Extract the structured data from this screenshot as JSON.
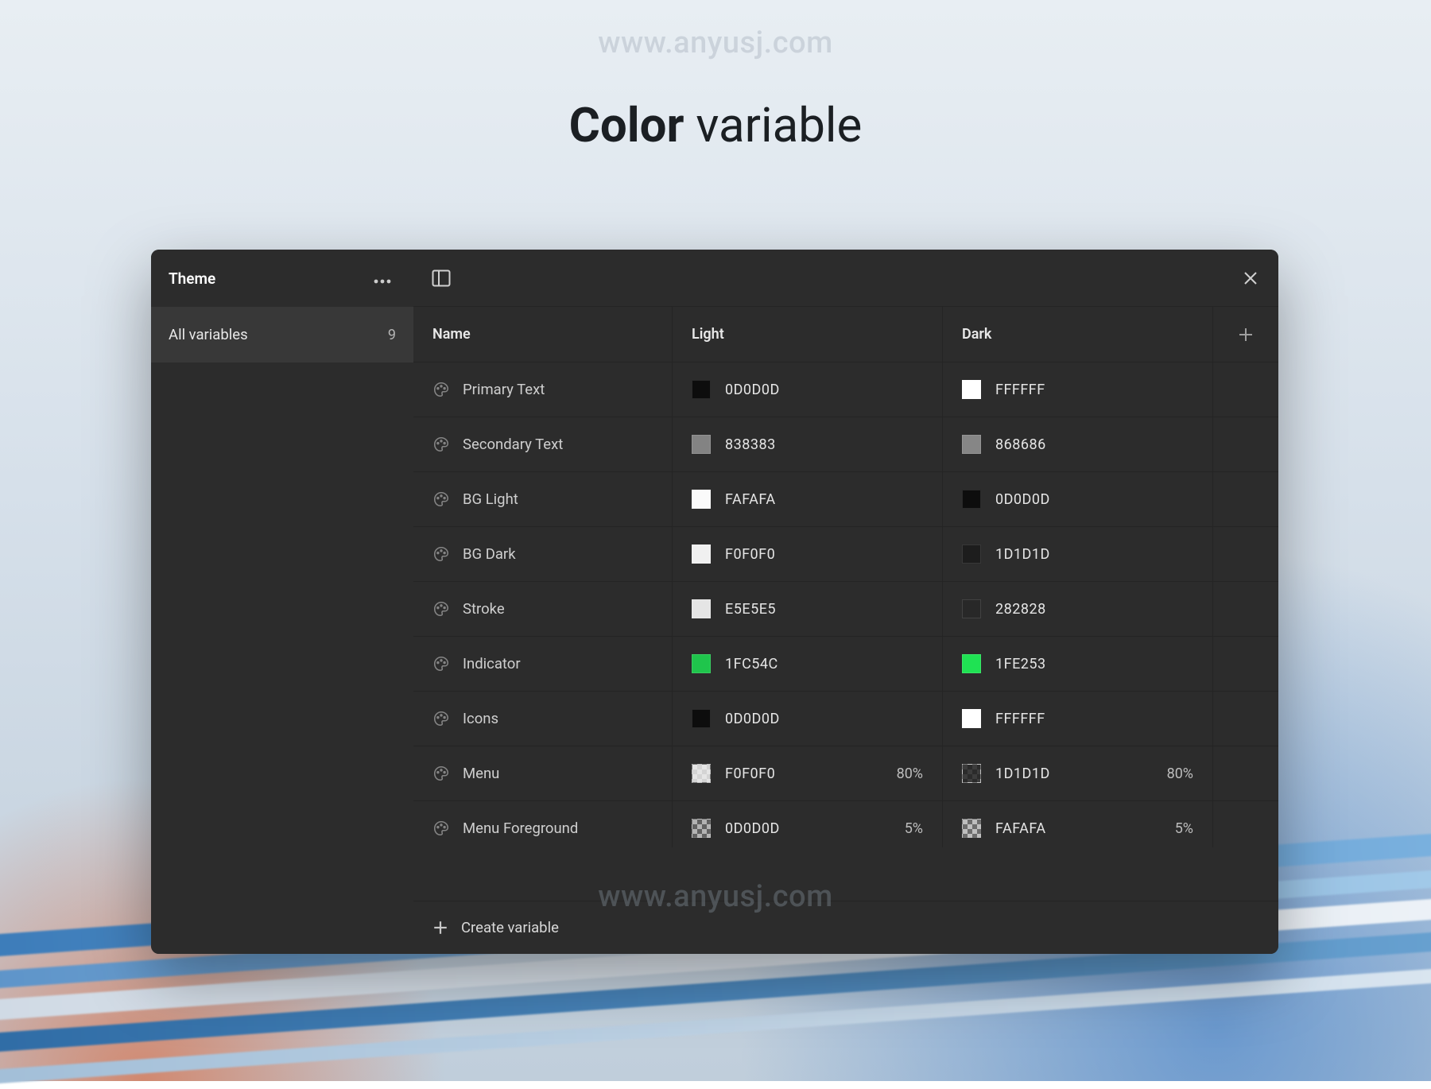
{
  "watermark": "www.anyusj.com",
  "title_bold": "Color",
  "title_light": " variable",
  "sidebar": {
    "header": "Theme",
    "item_label": "All variables",
    "item_count": "9"
  },
  "columns": {
    "name": "Name",
    "light": "Light",
    "dark": "Dark"
  },
  "footer": {
    "create": "Create variable"
  },
  "variables": [
    {
      "name": "Primary Text",
      "light": {
        "hex": "0D0D0D",
        "color": "#0d0d0d"
      },
      "dark": {
        "hex": "FFFFFF",
        "color": "#ffffff"
      }
    },
    {
      "name": "Secondary Text",
      "light": {
        "hex": "838383",
        "color": "#838383"
      },
      "dark": {
        "hex": "868686",
        "color": "#868686"
      }
    },
    {
      "name": "BG Light",
      "light": {
        "hex": "FAFAFA",
        "color": "#fafafa"
      },
      "dark": {
        "hex": "0D0D0D",
        "color": "#0d0d0d"
      }
    },
    {
      "name": "BG Dark",
      "light": {
        "hex": "F0F0F0",
        "color": "#f0f0f0"
      },
      "dark": {
        "hex": "1D1D1D",
        "color": "#1d1d1d"
      }
    },
    {
      "name": "Stroke",
      "light": {
        "hex": "E5E5E5",
        "color": "#e5e5e5"
      },
      "dark": {
        "hex": "282828",
        "color": "#282828"
      }
    },
    {
      "name": "Indicator",
      "light": {
        "hex": "1FC54C",
        "color": "#1fc54c"
      },
      "dark": {
        "hex": "1FE253",
        "color": "#1fe253"
      }
    },
    {
      "name": "Icons",
      "light": {
        "hex": "0D0D0D",
        "color": "#0d0d0d"
      },
      "dark": {
        "hex": "FFFFFF",
        "color": "#ffffff"
      }
    },
    {
      "name": "Menu",
      "light": {
        "hex": "F0F0F0",
        "color": "#f0f0f0",
        "opacity": "80%"
      },
      "dark": {
        "hex": "1D1D1D",
        "color": "#1d1d1d",
        "opacity": "80%"
      }
    },
    {
      "name": "Menu Foreground",
      "light": {
        "hex": "0D0D0D",
        "color": "#0d0d0d",
        "opacity": "5%"
      },
      "dark": {
        "hex": "FAFAFA",
        "color": "#fafafa",
        "opacity": "5%"
      }
    }
  ]
}
